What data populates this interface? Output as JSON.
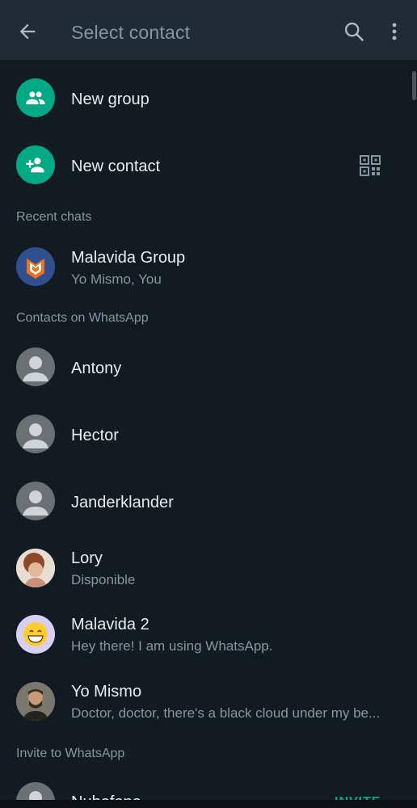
{
  "appbar": {
    "title": "Select contact",
    "back_icon": "arrow-left-icon",
    "search_icon": "search-icon",
    "more_icon": "more-vertical-icon"
  },
  "actions": [
    {
      "label": "New group",
      "icon": "group-icon"
    },
    {
      "label": "New contact",
      "icon": "person-add-icon",
      "extra_icon": "qr-code-icon"
    }
  ],
  "sections": {
    "recent": "Recent chats",
    "contacts": "Contacts on WhatsApp",
    "invite": "Invite to WhatsApp"
  },
  "recent_chats": [
    {
      "name": "Malavida Group",
      "subtitle": "Yo Mismo, You"
    }
  ],
  "contacts": [
    {
      "name": "Antony",
      "subtitle": ""
    },
    {
      "name": "Hector",
      "subtitle": ""
    },
    {
      "name": "Janderklander",
      "subtitle": ""
    },
    {
      "name": "Lory",
      "subtitle": "Disponible"
    },
    {
      "name": "Malavida 2",
      "subtitle": "Hey there! I am using WhatsApp."
    },
    {
      "name": "Yo Mismo",
      "subtitle": "Doctor, doctor, there's a black cloud under my be..."
    }
  ],
  "invite_contacts": [
    {
      "name": "Nubefono",
      "action": "INVITE"
    }
  ],
  "colors": {
    "background": "#121b22",
    "appbar": "#1f2c34",
    "accent": "#00a884",
    "secondary_text": "#8696a0",
    "primary_text": "#e9edef"
  }
}
